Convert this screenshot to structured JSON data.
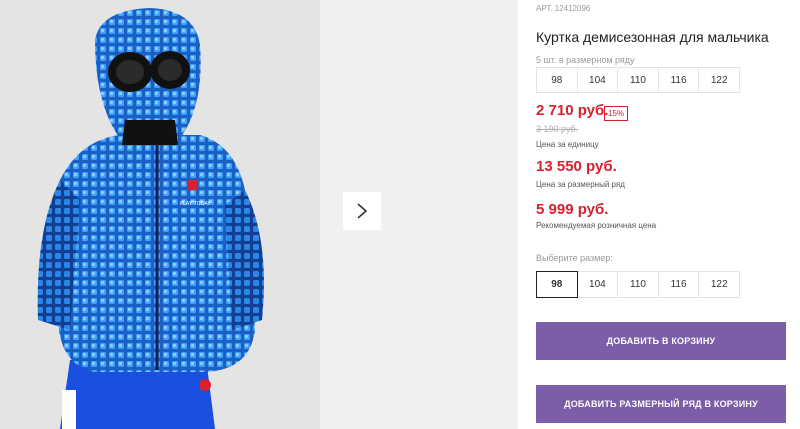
{
  "product": {
    "article": "АРТ. 12412096",
    "title": "Куртка демисезонная для мальчика"
  },
  "series": {
    "label": "5 шт. в размерном ряду",
    "sizes": [
      "98",
      "104",
      "110",
      "116",
      "122"
    ]
  },
  "prices": {
    "unit_price": "2 710 руб.",
    "discount": "15%",
    "old_price": "3 190 руб.",
    "unit_note": "Цена за единицу",
    "series_price": "13 550 руб.",
    "series_note": "Цена за размерный ряд",
    "retail_price": "5 999 руб.",
    "retail_note": "Рекомендуемая розничная цена"
  },
  "size_picker": {
    "label": "Выберите размер:",
    "options": [
      "98",
      "104",
      "110",
      "116",
      "122"
    ],
    "selected": "98"
  },
  "buttons": {
    "add_to_cart": "ДОБАВИТЬ В КОРЗИНУ",
    "add_series": "ДОБАВИТЬ РАЗМЕРНЫЙ РЯД В КОРЗИНУ"
  },
  "gallery": {
    "next_icon": "chevron-right-icon"
  },
  "colors": {
    "accent": "#7b5ea7",
    "price_red": "#d8202e",
    "jacket_blue": "#1e6fd9",
    "pants_blue": "#1a4fe0"
  }
}
